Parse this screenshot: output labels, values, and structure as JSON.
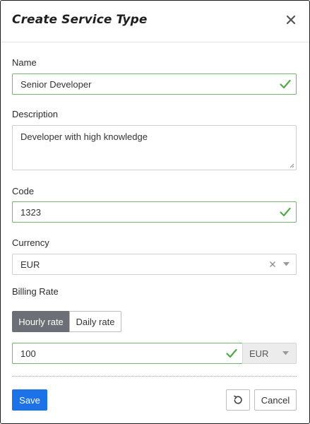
{
  "dialog": {
    "title": "Create Service Type"
  },
  "form": {
    "name": {
      "label": "Name",
      "value": "Senior Developer"
    },
    "description": {
      "label": "Description",
      "value": "Developer with high knowledge"
    },
    "code": {
      "label": "Code",
      "value": "1323"
    },
    "currency": {
      "label": "Currency",
      "value": "EUR"
    },
    "billing_rate": {
      "label": "Billing Rate",
      "options": [
        "Hourly rate",
        "Daily rate"
      ],
      "selected": "Hourly rate",
      "amount": "100",
      "currency": "EUR"
    }
  },
  "footer": {
    "save_label": "Save",
    "cancel_label": "Cancel"
  },
  "colors": {
    "primary": "#1d72e8",
    "valid": "#6fb86b",
    "segment_active": "#6c6f75"
  },
  "icons": [
    "close-icon",
    "check-icon",
    "clear-icon",
    "chevron-down-icon",
    "reset-icon",
    "resize-handle-icon"
  ]
}
